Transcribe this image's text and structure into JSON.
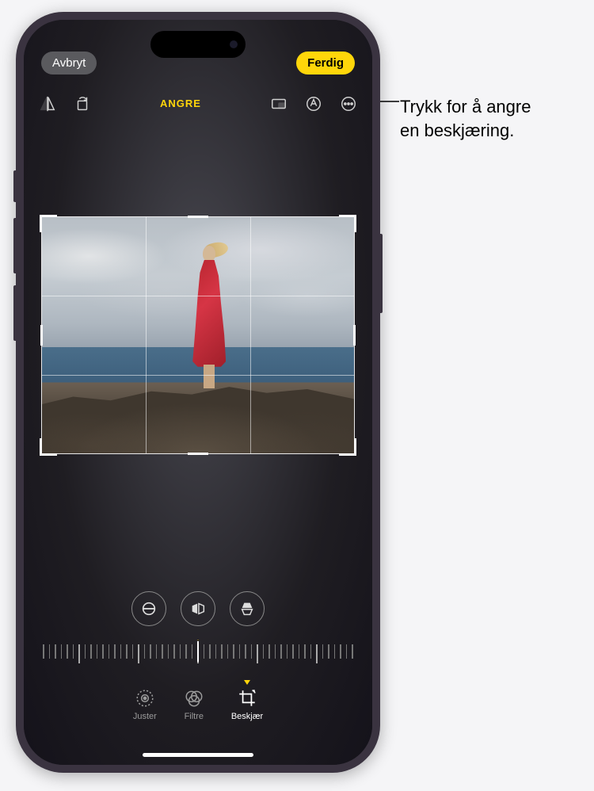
{
  "header": {
    "cancel_label": "Avbryt",
    "done_label": "Ferdig"
  },
  "toolbar": {
    "undo_label": "ANGRE",
    "icons": {
      "flip": "flip-horizontal-icon",
      "rotate": "rotate-icon",
      "aspect": "aspect-ratio-icon",
      "markup": "markup-icon",
      "more": "more-icon"
    }
  },
  "adjust_row": {
    "straighten": "straighten-icon",
    "flip_h": "flip-horizontal-icon",
    "flip_v": "flip-vertical-icon"
  },
  "modes": {
    "adjust": "Juster",
    "filters": "Filtre",
    "crop": "Beskjær"
  },
  "active_mode": "crop",
  "callout": {
    "line1": "Trykk for å angre",
    "line2": "en beskjæring."
  },
  "colors": {
    "accent": "#ffd60a"
  }
}
